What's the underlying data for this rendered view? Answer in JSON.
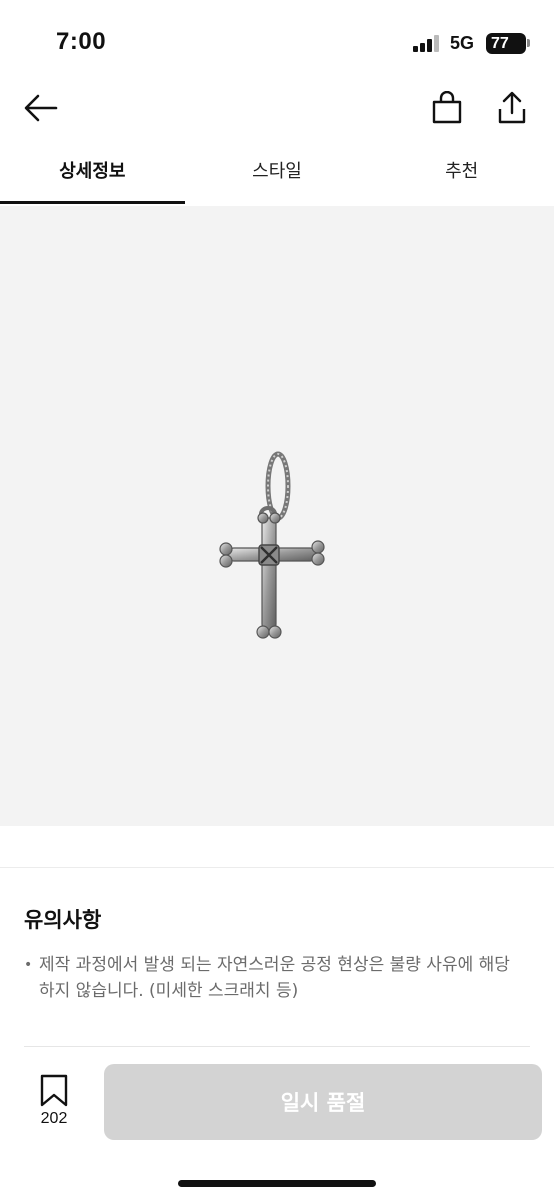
{
  "status_bar": {
    "time": "7:00",
    "network": "5G",
    "battery": "77"
  },
  "header": {
    "back_icon": "arrow-left-icon",
    "bag_icon": "shopping-bag-icon",
    "share_icon": "share-icon"
  },
  "tabs": [
    {
      "label": "상세정보",
      "active": true
    },
    {
      "label": "스타일",
      "active": false
    },
    {
      "label": "추천",
      "active": false
    }
  ],
  "product_image": {
    "subject": "cross-pendant",
    "background": "#f3f3f3"
  },
  "notice": {
    "title": "유의사항",
    "items": [
      "제작 과정에서 발생 되는 자연스러운 공정 현상은 불량 사유에 해당 하지 않습니다. (미세한 스크래치 등)"
    ]
  },
  "bottom_bar": {
    "bookmark_icon": "bookmark-icon",
    "bookmark_count": "202",
    "cta_label": "일시 품절",
    "cta_color": "#d3d3d3"
  }
}
